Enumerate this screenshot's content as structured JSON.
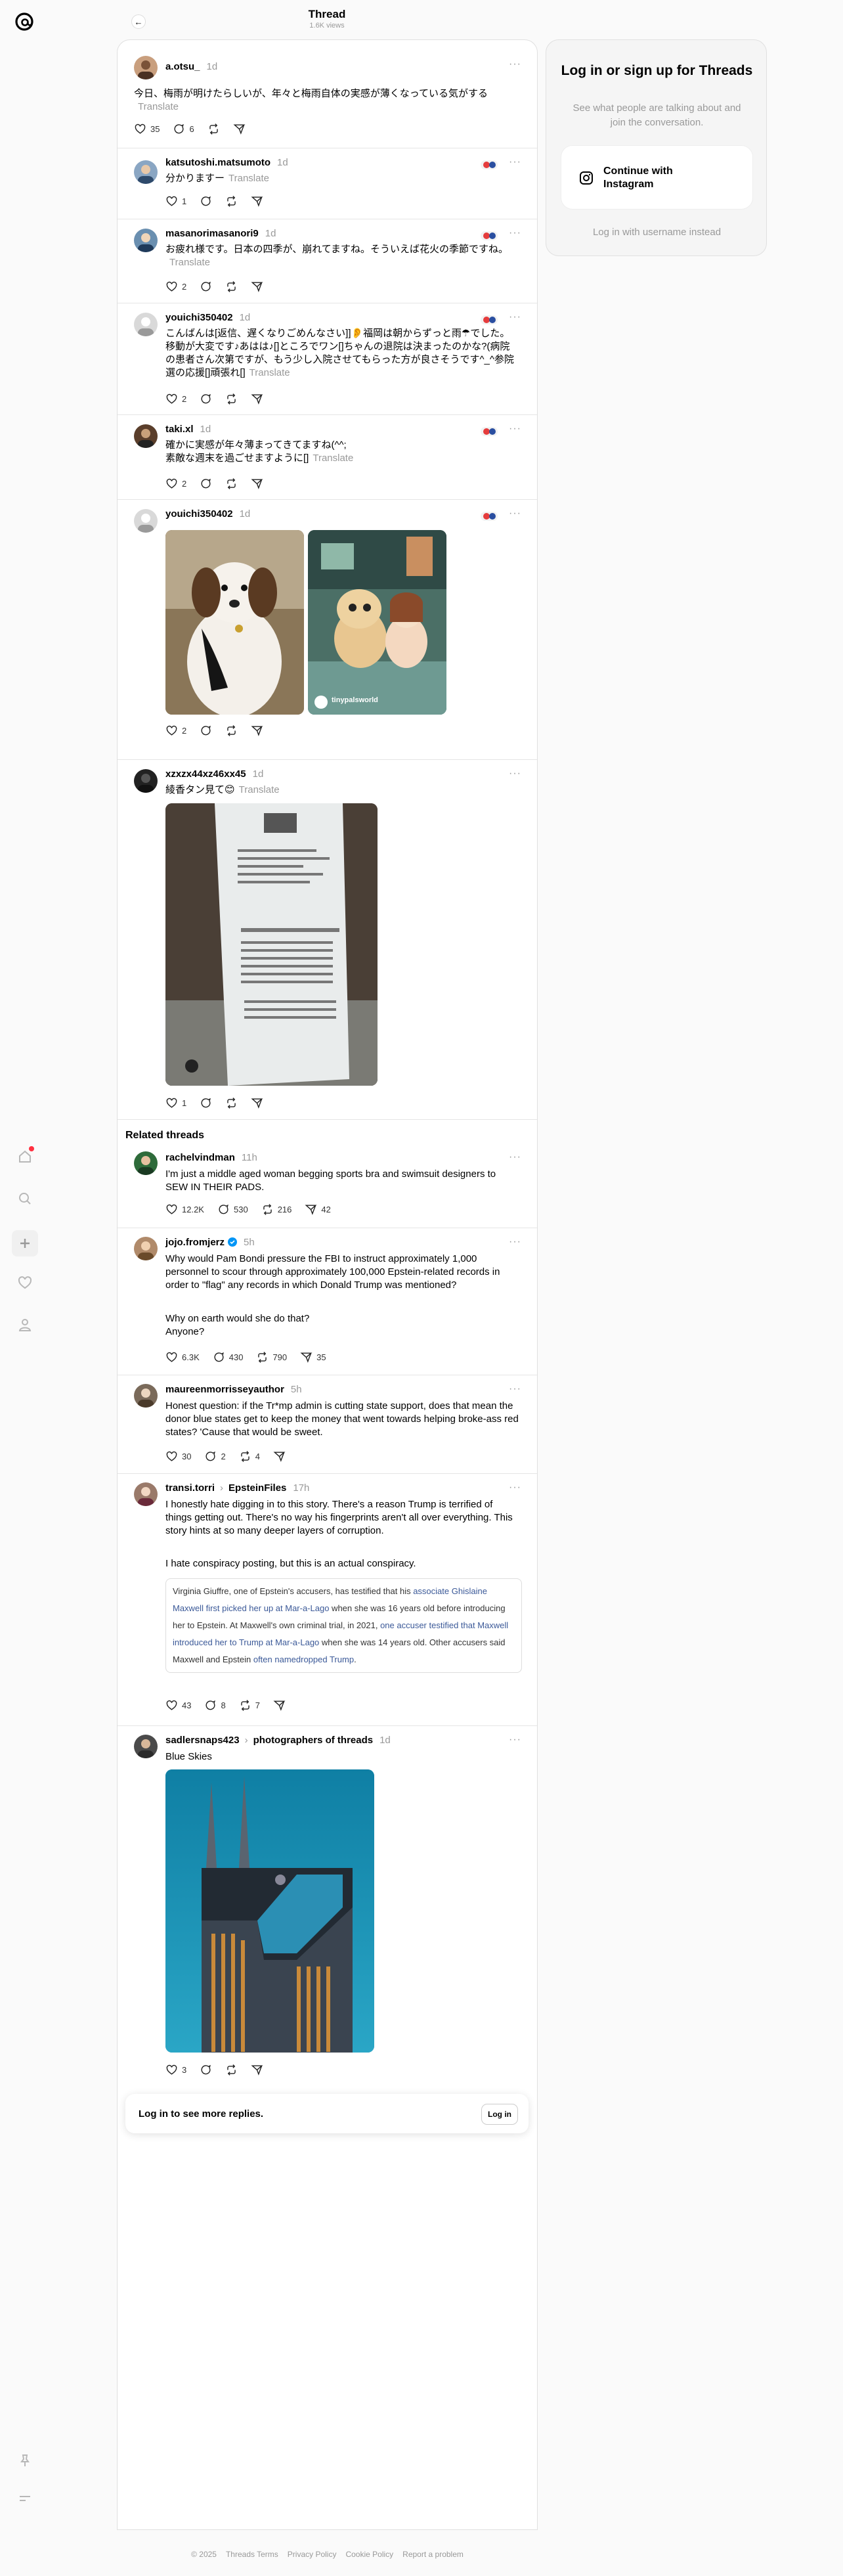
{
  "header": {
    "title": "Thread",
    "views": "1.6K views"
  },
  "posts": [
    {
      "user": "a.otsu_",
      "time": "1d",
      "text": "今日、梅雨が明けたらしいが、年々と梅雨自体の実感が薄くなっている気がする",
      "translate": "Translate",
      "likes": "35",
      "replies": "6"
    },
    {
      "user": "katsutoshi.matsumoto",
      "time": "1d",
      "text": "分かりますー",
      "translate": "Translate",
      "likes": "1"
    },
    {
      "user": "masanorimasanori9",
      "time": "1d",
      "text": "お疲れ様です。日本の四季が、崩れてますね。そういえば花火の季節ですね。",
      "translate": "Translate",
      "likes": "2"
    },
    {
      "user": "youichi350402",
      "time": "1d",
      "text": "こんばんは[返信、遅くなりごめんなさい]]👂福岡は朝からずっと雨☂でした。移動が大変です♪あはは♪[]ところでワン[]ちゃんの退院は決まったのかな?(病院の患者さん次第ですが、もう少し入院させてもらった方が良さそうです^_^参院選の応援[]頑張れ[]",
      "translate": "Translate",
      "likes": "2"
    },
    {
      "user": "taki.xl",
      "time": "1d",
      "text": "確かに実感が年々薄まってきてますね(^^;\n素敵な週末を過ごせますように[]",
      "translate": "Translate",
      "likes": "2"
    },
    {
      "user": "youichi350402",
      "time": "1d",
      "likes": "2",
      "watermark": "tinypalsworld"
    },
    {
      "user": "xzxzx44xz46xx45",
      "time": "1d",
      "text": "綾香タン見て😊",
      "translate": "Translate",
      "likes": "1"
    }
  ],
  "related": {
    "heading": "Related threads",
    "items": [
      {
        "user": "rachelvindman",
        "time": "11h",
        "text": "I'm just a middle aged woman begging sports bra and swimsuit designers to SEW IN THEIR PADS.",
        "likes": "12.2K",
        "replies": "530",
        "reposts": "216",
        "shares": "42"
      },
      {
        "user": "jojo.fromjerz",
        "time": "5h",
        "text": "Why would Pam Bondi pressure the FBI to instruct approximately 1,000 personnel to scour through approximately 100,000 Epstein-related records in order to \"flag\" any records in which Donald Trump was mentioned?",
        "text2": "Why on earth would she do that?\nAnyone?",
        "likes": "6.3K",
        "replies": "430",
        "reposts": "790",
        "shares": "35"
      },
      {
        "user": "maureenmorrisseyauthor",
        "time": "5h",
        "text": "Honest question: if the Tr*mp admin is cutting state support, does that mean the donor blue states get to keep the money that went towards helping broke-ass red states? 'Cause that would be sweet.",
        "likes": "30",
        "replies": "2",
        "reposts": "4"
      },
      {
        "user": "transi.torri",
        "topic": "EpsteinFiles",
        "time": "17h",
        "text": "I honestly hate digging in to this story. There's a reason Trump is terrified of things getting out. There's no way his fingerprints aren't all over everything. This story hints at so many deeper layers of corruption.",
        "text2": "I hate conspiracy posting, but this is an actual conspiracy.",
        "quote": [
          {
            "t": "Virginia Giuffre, one of Epstein's accusers, has testified that his "
          },
          {
            "t": "associate Ghislaine Maxwell first picked her up at Mar-a-Lago",
            "l": 1
          },
          {
            "t": " when she was 16 years old before introducing her to Epstein. At Maxwell's own criminal trial, in 2021, "
          },
          {
            "t": "one accuser testified that Maxwell introduced her to Trump at Mar-a-Lago",
            "l": 1
          },
          {
            "t": " when she was 14 years old. Other accusers said Maxwell and Epstein "
          },
          {
            "t": "often namedropped Trump",
            "l": 1
          },
          {
            "t": "."
          }
        ],
        "likes": "43",
        "replies": "8",
        "reposts": "7"
      },
      {
        "user": "sadlersnaps423",
        "topic": "photographers of threads",
        "time": "1d",
        "text": "Blue Skies",
        "likes": "3"
      }
    ]
  },
  "login_bar": {
    "text": "Log in to see more replies.",
    "button": "Log in"
  },
  "sidebar": {
    "title": "Log in or sign up for Threads",
    "subtitle": "See what people are talking about and join the conversation.",
    "instagram": "Continue with Instagram",
    "alt": "Log in with username instead"
  },
  "footer": [
    "© 2025",
    "Threads Terms",
    "Privacy Policy",
    "Cookie Policy",
    "Report a problem"
  ]
}
